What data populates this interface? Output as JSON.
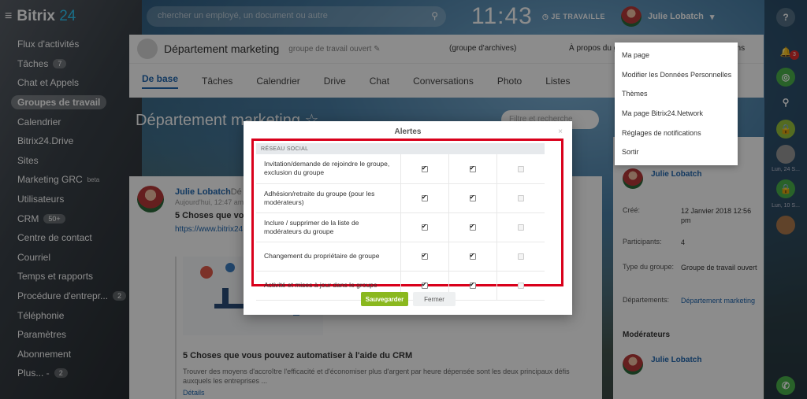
{
  "app": {
    "logo_text": "Bitrix",
    "logo_num": "24"
  },
  "sidebar": {
    "items": [
      {
        "label": "Flux d'activités",
        "counter": ""
      },
      {
        "label": "Tâches",
        "counter": "7"
      },
      {
        "label": "Chat et Appels",
        "counter": ""
      },
      {
        "label": "Groupes de travail",
        "counter": "",
        "active": true
      },
      {
        "label": "Calendrier",
        "counter": ""
      },
      {
        "label": "Bitrix24.Drive",
        "counter": ""
      },
      {
        "label": "Sites",
        "counter": ""
      },
      {
        "label": "Marketing GRC",
        "counter": "",
        "sup": "beta"
      },
      {
        "label": "Utilisateurs",
        "counter": ""
      },
      {
        "label": "CRM",
        "counter": "50+"
      },
      {
        "label": "Centre de contact",
        "counter": ""
      },
      {
        "label": "Courriel",
        "counter": ""
      },
      {
        "label": "Temps et rapports",
        "counter": ""
      },
      {
        "label": "Procédure d'entrepr...",
        "counter": "2"
      },
      {
        "label": "Téléphonie",
        "counter": ""
      },
      {
        "label": "Paramètres",
        "counter": ""
      },
      {
        "label": "Abonnement",
        "counter": ""
      },
      {
        "label": "Plus... -",
        "counter": "2"
      }
    ]
  },
  "topbar": {
    "search_placeholder": "chercher un employé, un document ou autre",
    "clock": "11:43",
    "clock_status": "JE TRAVAILLE",
    "user_name": "Julie Lobatch"
  },
  "rightbar": {
    "help": "?",
    "notif_badge": "3",
    "label1": "Lun, 24 S...",
    "label2": "Lun, 10 S..."
  },
  "workgroup": {
    "title": "Département marketing",
    "type": "groupe de travail ouvert",
    "archive": "(groupe d'archives)",
    "about": "À propos du gr",
    "actions": "tions",
    "tabs": [
      "De base",
      "Tâches",
      "Calendrier",
      "Drive",
      "Chat",
      "Conversations",
      "Photo",
      "Listes"
    ],
    "page_title": "Département marketing",
    "filter_placeholder": "Filtre et recherche"
  },
  "feed": {
    "author": "Julie Lobatch",
    "arrow": "› Dé",
    "time": "Aujourd'hui, 12:47 am",
    "post_title": "5 Choses que vous",
    "post_link": "https://www.bitrix24.f",
    "card_title": "5 Choses que vous pouvez automatiser à l'aide du CRM",
    "card_desc": "Trouver des moyens d'accroître l'efficacité et d'économiser plus d'argent par heure dépensée sont les deux principaux défis auxquels les entreprises ...",
    "card_more": "Détails"
  },
  "info": {
    "owner": "Julie Lobatch",
    "created_label": "Créé:",
    "created_value": "12 Janvier 2018 12:56 pm",
    "participants_label": "Participants:",
    "participants_value": "4",
    "type_label": "Type du groupe:",
    "type_value": "Groupe de travail ouvert",
    "dept_label": "Départements:",
    "dept_value": "Département marketing",
    "moderators_heading": "Modérateurs",
    "moderator_name": "Julie Lobatch"
  },
  "dropdown": {
    "items": [
      "Ma page",
      "Modifier les Données Personnelles",
      "Thèmes",
      "Ma page Bitrix24.Network",
      "Réglages de notifications",
      "Sortir"
    ]
  },
  "modal": {
    "title": "Alertes",
    "close": "×",
    "section": "RÉSEAU SOCIAL",
    "rows": [
      {
        "label": "Invitation/demande de rejoindre le groupe, exclusion du groupe",
        "c1": true,
        "c2": true,
        "c3": false
      },
      {
        "label": "Adhésion/retraite du groupe (pour les modérateurs)",
        "c1": true,
        "c2": true,
        "c3": false
      },
      {
        "label": "Inclure / supprimer de la liste de modérateurs du groupe",
        "c1": true,
        "c2": true,
        "c3": false
      },
      {
        "label": "Changement du propriétaire de groupe",
        "c1": true,
        "c2": true,
        "c3": false
      },
      {
        "label": "Activité et mises à jour dans le groupe",
        "c1": true,
        "c2": true,
        "c3": false
      }
    ],
    "save_label": "Sauvegarder",
    "close_label": "Fermer"
  },
  "colors": {
    "accent": "#2067b0",
    "save": "#8ab81e",
    "highlight": "#d9001b"
  }
}
